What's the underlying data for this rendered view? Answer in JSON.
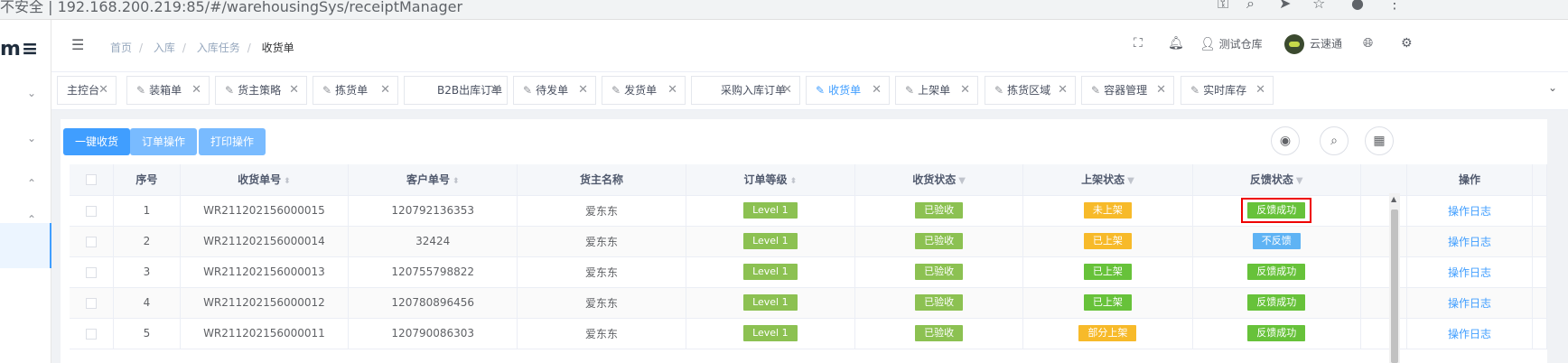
{
  "browser": {
    "url": "不安全 | 192.168.200.219:85/#/warehousingSys/receiptManager"
  },
  "sidebar": {
    "logo": "m≡"
  },
  "header": {
    "breadcrumb": [
      "首页",
      "入库",
      "入库任务",
      "收货单"
    ],
    "warehouse": "测试仓库",
    "user": "云速通"
  },
  "tabs": [
    {
      "label": "主控台",
      "icon": false,
      "active": false
    },
    {
      "label": "装箱单",
      "icon": true,
      "active": false
    },
    {
      "label": "货主策略",
      "icon": true,
      "active": false
    },
    {
      "label": "拣货单",
      "icon": true,
      "active": false
    },
    {
      "label": "B2B出库订单",
      "icon": false,
      "active": false
    },
    {
      "label": "待发单",
      "icon": true,
      "active": false
    },
    {
      "label": "发货单",
      "icon": true,
      "active": false
    },
    {
      "label": "采购入库订单",
      "icon": false,
      "active": false
    },
    {
      "label": "收货单",
      "icon": true,
      "active": true
    },
    {
      "label": "上架单",
      "icon": true,
      "active": false
    },
    {
      "label": "拣货区域",
      "icon": true,
      "active": false
    },
    {
      "label": "容器管理",
      "icon": true,
      "active": false
    },
    {
      "label": "实时库存",
      "icon": true,
      "active": false
    }
  ],
  "toolbar": {
    "b1": "一键收货",
    "b2": "订单操作",
    "b3": "打印操作"
  },
  "table": {
    "headers": [
      "序号",
      "收货单号",
      "客户单号",
      "货主名称",
      "订单等级",
      "收货状态",
      "上架状态",
      "反馈状态",
      "操作"
    ],
    "rows": [
      {
        "no": "1",
        "receipt": "WR211202156000015",
        "customer": "120792136353",
        "owner": "爱东东",
        "level": "Level 1",
        "recv": "已验收",
        "shelf": "未上架",
        "shelf_color": "orange",
        "feedback": "反馈成功",
        "fb_color": "green2",
        "op": "操作日志"
      },
      {
        "no": "2",
        "receipt": "WR211202156000014",
        "customer": "32424",
        "owner": "爱东东",
        "level": "Level 1",
        "recv": "已验收",
        "shelf": "已上架",
        "shelf_color": "orange",
        "feedback": "不反馈",
        "fb_color": "blue",
        "op": "操作日志"
      },
      {
        "no": "3",
        "receipt": "WR211202156000013",
        "customer": "120755798822",
        "owner": "爱东东",
        "level": "Level 1",
        "recv": "已验收",
        "shelf": "已上架",
        "shelf_color": "green2",
        "feedback": "反馈成功",
        "fb_color": "green2",
        "op": "操作日志"
      },
      {
        "no": "4",
        "receipt": "WR211202156000012",
        "customer": "120780896456",
        "owner": "爱东东",
        "level": "Level 1",
        "recv": "已验收",
        "shelf": "已上架",
        "shelf_color": "green2",
        "feedback": "反馈成功",
        "fb_color": "green2",
        "op": "操作日志"
      },
      {
        "no": "5",
        "receipt": "WR211202156000011",
        "customer": "120790086303",
        "owner": "爱东东",
        "level": "Level 1",
        "recv": "已验收",
        "shelf": "部分上架",
        "shelf_color": "orange",
        "feedback": "反馈成功",
        "fb_color": "green2",
        "op": "操作日志"
      }
    ]
  },
  "colors": {
    "accent": "#409eff",
    "green": "#8cc152",
    "orange": "#f7ba2a",
    "highlight": "#e00000"
  }
}
